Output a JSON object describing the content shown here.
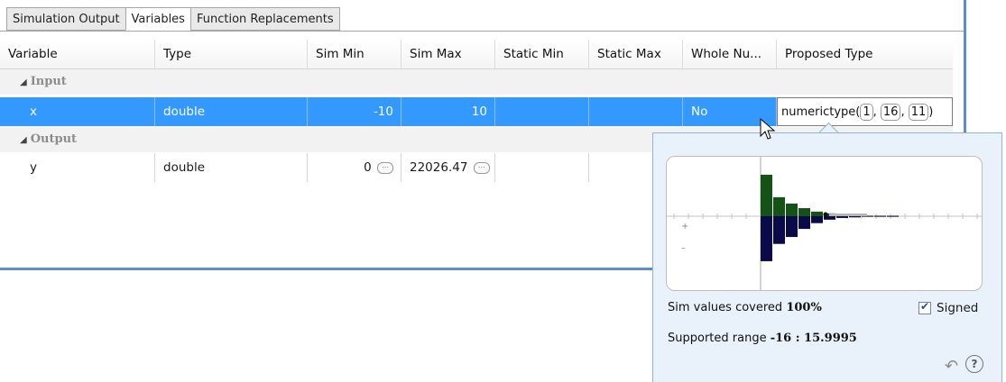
{
  "tabs": [
    "Simulation Output",
    "Variables",
    "Function Replacements"
  ],
  "active_tab": "Variables",
  "columns": [
    "Variable",
    "Type",
    "Sim Min",
    "Sim Max",
    "Static Min",
    "Static Max",
    "Whole Nu...",
    "Proposed Type"
  ],
  "groups": {
    "input": "Input",
    "output": "Output"
  },
  "rows": {
    "x": {
      "variable": "x",
      "type": "double",
      "sim_min": "-10",
      "sim_max": "10",
      "static_min": "",
      "static_max": "",
      "whole": "No",
      "proposed": {
        "prefix": "numerictype(",
        "a": "1",
        "sep1": ", ",
        "b": "16",
        "sep2": ", ",
        "c": "11",
        "suffix": ")"
      }
    },
    "y": {
      "variable": "y",
      "type": "double",
      "sim_min": "0",
      "sim_max": "22026.47",
      "static_min": "",
      "static_max": "",
      "whole": "",
      "proposed": ""
    }
  },
  "popup": {
    "plus": "+",
    "minus": "–",
    "covered_label": "Sim values covered",
    "covered_value": "100%",
    "signed_label": "Signed",
    "signed_checked": true,
    "range_label": "Supported range",
    "range_value": "-16 : 15.9995"
  },
  "icons": {
    "tri": "◢",
    "ellipsis": "⋯",
    "undo": "↶",
    "help": "?"
  },
  "colors": {
    "selection": "#3399ff",
    "positive_bars": "#155215",
    "negative_bars": "#0a0a4a",
    "popup_bg": "#e9f1fa"
  },
  "histogram": {
    "positive": [
      0,
      0.72,
      0.33,
      0.22,
      0.14,
      0.08,
      0.05,
      0.03,
      0.02,
      0.01,
      0.01,
      0.01
    ],
    "negative": [
      0,
      0.78,
      0.48,
      0.36,
      0.22,
      0.12,
      0.06,
      0.03,
      0.02,
      0.01,
      0.01,
      0.01
    ]
  }
}
